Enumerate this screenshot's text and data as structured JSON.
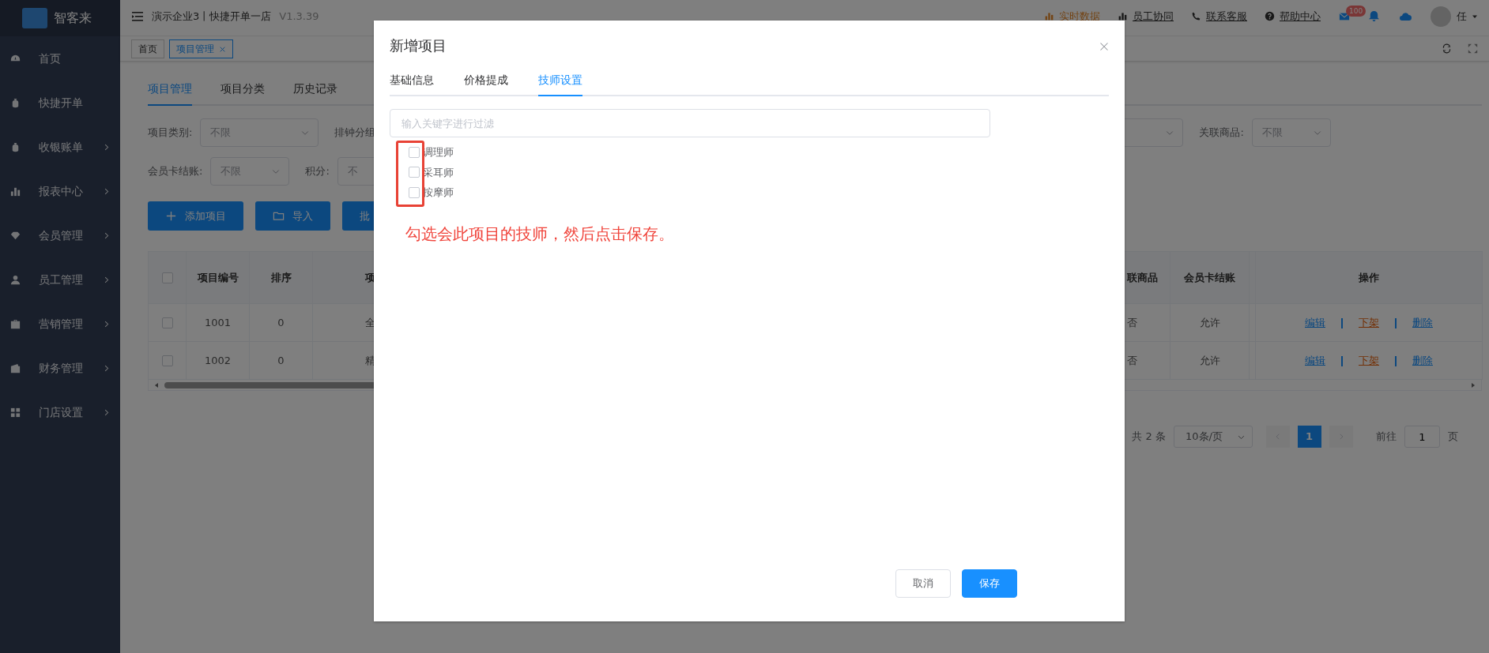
{
  "sidebar": {
    "logo_text": "智客来",
    "items": [
      {
        "label": "首页",
        "expandable": false
      },
      {
        "label": "快捷开单",
        "expandable": false
      },
      {
        "label": "收银账单",
        "expandable": true
      },
      {
        "label": "报表中心",
        "expandable": true
      },
      {
        "label": "会员管理",
        "expandable": true
      },
      {
        "label": "员工管理",
        "expandable": true
      },
      {
        "label": "营销管理",
        "expandable": true
      },
      {
        "label": "财务管理",
        "expandable": true
      },
      {
        "label": "门店设置",
        "expandable": true
      }
    ]
  },
  "header": {
    "title": "演示企业3丨快捷开单一店",
    "version": "V1.3.39",
    "links": [
      {
        "label": "实时数据"
      },
      {
        "label": "员工协同"
      },
      {
        "label": "联系客服"
      },
      {
        "label": "帮助中心"
      }
    ],
    "mail_badge": "100",
    "user": "任"
  },
  "page_tabs": [
    {
      "label": "首页",
      "selected": false,
      "closable": false
    },
    {
      "label": "项目管理",
      "selected": true,
      "closable": true
    }
  ],
  "content": {
    "tabs": [
      {
        "label": "项目管理",
        "selected": true
      },
      {
        "label": "项目分类",
        "selected": false
      },
      {
        "label": "历史记录",
        "selected": false
      }
    ],
    "filter_rows": [
      [
        {
          "label": "项目类别:",
          "value": "不限"
        },
        {
          "label": "排钟分组"
        },
        {
          "label": "关联商品:",
          "value": "不限"
        }
      ],
      [
        {
          "label": "会员卡结账:",
          "value": "不限"
        },
        {
          "label": "积分:",
          "value": "不"
        }
      ]
    ],
    "actions": [
      {
        "label": "添加项目"
      },
      {
        "label": "导入"
      },
      {
        "label": "批"
      }
    ],
    "table": {
      "header_checked": false,
      "columns": [
        {
          "label": "项目编号"
        },
        {
          "label": "排序"
        },
        {
          "label": "项"
        },
        {
          "label": "联商品"
        },
        {
          "label": "会员卡结账"
        },
        {
          "label": "操作"
        }
      ],
      "rows": [
        {
          "checked": false,
          "cells": [
            "1001",
            "0",
            "全",
            "否",
            "允许"
          ],
          "actions": [
            {
              "label": "编辑",
              "kind": "edit"
            },
            {
              "label": "下架",
              "kind": "offshelf"
            },
            {
              "label": "删除",
              "kind": "delete"
            }
          ]
        },
        {
          "checked": false,
          "cells": [
            "1002",
            "0",
            "精",
            "否",
            "允许"
          ],
          "actions": [
            {
              "label": "编辑",
              "kind": "edit"
            },
            {
              "label": "下架",
              "kind": "offshelf"
            },
            {
              "label": "删除",
              "kind": "delete"
            }
          ]
        }
      ]
    },
    "pagination": {
      "total": "共 2 条",
      "page_size": "10条/页",
      "pages": [
        {
          "label": "1",
          "selected": true
        }
      ],
      "goto_label": "前往",
      "goto_value": "1",
      "page_suffix": "页"
    }
  },
  "dialog": {
    "title": "新增项目",
    "tabs": [
      {
        "label": "基础信息",
        "selected": false
      },
      {
        "label": "价格提成",
        "selected": false
      },
      {
        "label": "技师设置",
        "selected": true
      }
    ],
    "filter": {
      "placeholder": "输入关键字进行过滤"
    },
    "technicians": [
      {
        "label": "调理师",
        "checked": false
      },
      {
        "label": "采耳师",
        "checked": false
      },
      {
        "label": "按摩师",
        "checked": false
      }
    ],
    "annotation": "勾选会此项目的技师，然后点击保存。",
    "buttons": [
      {
        "label": "取消",
        "kind": "secondary"
      },
      {
        "label": "保存",
        "kind": "primary"
      }
    ]
  }
}
